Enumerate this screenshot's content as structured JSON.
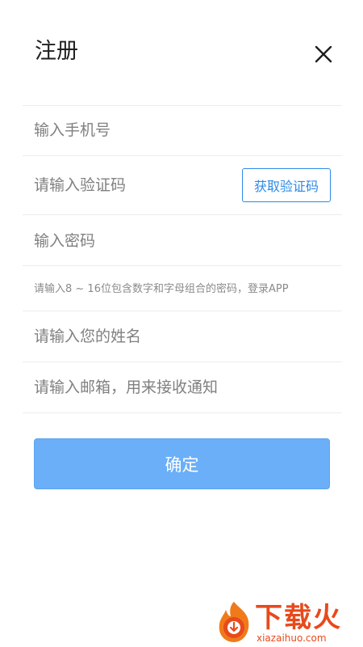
{
  "header": {
    "title": "注册",
    "close_icon": "close-icon"
  },
  "form": {
    "phone": {
      "value": "",
      "placeholder": "输入手机号"
    },
    "code": {
      "value": "",
      "placeholder": "请输入验证码"
    },
    "get_code_label": "获取验证码",
    "password": {
      "value": "",
      "placeholder": "输入密码"
    },
    "password_hint": "请输入8 ~ 16位包含数字和字母组合的密码，登录APP",
    "name": {
      "value": "",
      "placeholder": "请输入您的姓名"
    },
    "email": {
      "value": "",
      "placeholder": "请输入邮箱，用来接收通知"
    },
    "confirm_label": "确定"
  },
  "watermark": {
    "brand": "下载火",
    "url": "xiazaihuo.com"
  },
  "colors": {
    "accent": "#2d8ae6",
    "confirm_bg": "#6aaff7",
    "watermark": "#e84a1b",
    "divider": "#ececec"
  }
}
